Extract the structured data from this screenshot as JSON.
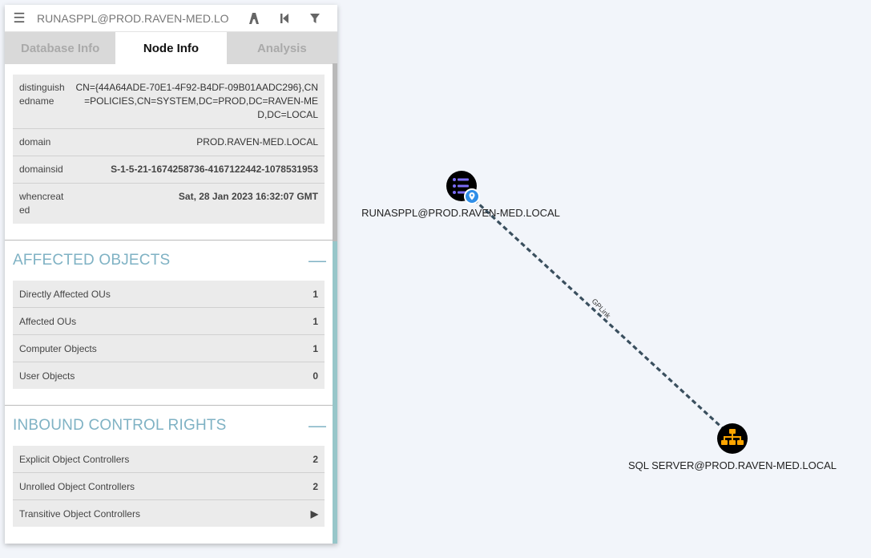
{
  "search": {
    "value": "RUNASPPL@PROD.RAVEN-MED.LO"
  },
  "tabs": [
    {
      "label": "Database Info"
    },
    {
      "label": "Node Info"
    },
    {
      "label": "Analysis"
    }
  ],
  "properties": [
    {
      "key": "distinguishedname",
      "value": "CN={44A64ADE-70E1-4F92-B4DF-09B01AADC296},CN=POLICIES,CN=SYSTEM,DC=PROD,DC=RAVEN-MED,DC=LOCAL"
    },
    {
      "key": "domain",
      "value": "PROD.RAVEN-MED.LOCAL"
    },
    {
      "key": "domainsid",
      "value": "S-1-5-21-1674258736-4167122442-1078531953"
    },
    {
      "key": "whencreated",
      "value": "Sat, 28 Jan 2023 16:32:07 GMT"
    }
  ],
  "affected": {
    "title": "AFFECTED OBJECTS",
    "rows": [
      {
        "label": "Directly Affected OUs",
        "value": "1"
      },
      {
        "label": "Affected OUs",
        "value": "1"
      },
      {
        "label": "Computer Objects",
        "value": "1"
      },
      {
        "label": "User Objects",
        "value": "0"
      }
    ]
  },
  "inbound": {
    "title": "INBOUND CONTROL RIGHTS",
    "rows": [
      {
        "label": "Explicit Object Controllers",
        "value": "2"
      },
      {
        "label": "Unrolled Object Controllers",
        "value": "2"
      },
      {
        "label": "Transitive Object Controllers",
        "value": "▶"
      }
    ]
  },
  "graph": {
    "nodes": [
      {
        "label": "RUNASPPL@PROD.RAVEN-MED.LOCAL",
        "type": "gpo",
        "icon": "list-icon",
        "badge": "location-pin-icon"
      },
      {
        "label": "SQL SERVER@PROD.RAVEN-MED.LOCAL",
        "type": "ou",
        "icon": "org-chart-icon"
      }
    ],
    "edge": {
      "label": "GPLink"
    },
    "colors": {
      "node_bg": "#000000",
      "gpo_icon": "#7b6cf6",
      "ou_icon": "#ffa500",
      "badge": "#2f8ee8",
      "edge": "#3a4f5e"
    }
  }
}
